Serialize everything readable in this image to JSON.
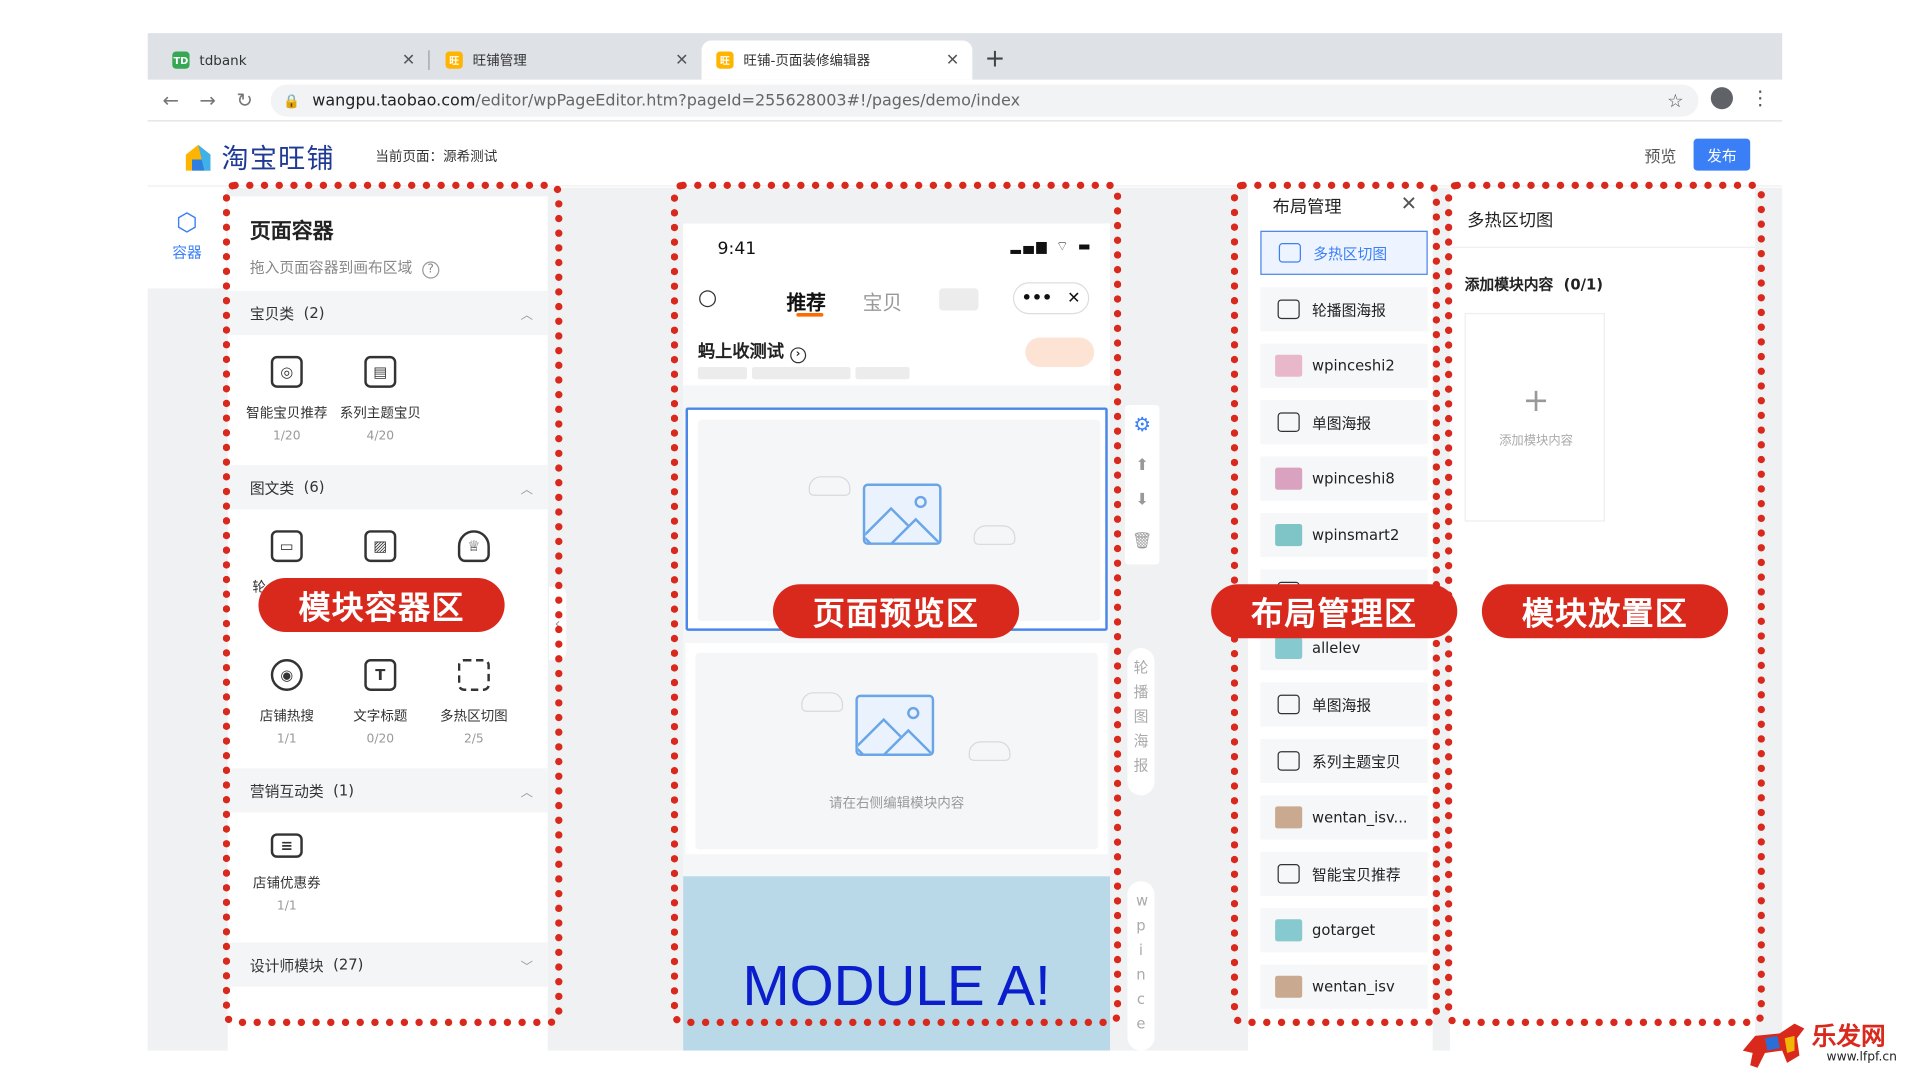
{
  "browser": {
    "tabs": [
      {
        "title": "tdbank",
        "favicon": "TD"
      },
      {
        "title": "旺铺管理"
      },
      {
        "title": "旺铺-页面装修编辑器"
      }
    ],
    "url_host": "wangpu.taobao.com",
    "url_path": "/editor/wpPageEditor.htm?pageId=255628003#!/pages/demo/index",
    "new_tab_icon": "+"
  },
  "app": {
    "logo_text": "淘宝旺铺",
    "current_page_label": "当前页面：",
    "current_page_value": "源希测试",
    "preview_button": "预览",
    "publish_button": "发布",
    "rail_label": "容器",
    "accent_color": "#3b7ff6"
  },
  "container_panel": {
    "title": "页面容器",
    "subtitle": "拖入页面容器到画布区域",
    "categories": [
      {
        "name": "宝贝类",
        "count": "(2)"
      },
      {
        "name": "图文类",
        "count": "(6)"
      },
      {
        "name": "营销互动类",
        "count": "(1)"
      },
      {
        "name": "设计师模块",
        "count": "(27)"
      }
    ],
    "modules": [
      {
        "name": "智能宝贝推荐",
        "count": "1/20"
      },
      {
        "name": "系列主题宝贝",
        "count": "4/20"
      },
      {
        "name": "店铺热搜",
        "count": "1/1"
      },
      {
        "name": "文字标题",
        "count": "0/20"
      },
      {
        "name": "多热区切图",
        "count": "2/5"
      },
      {
        "name": "店铺优惠券",
        "count": "1/1"
      }
    ],
    "partial_label": "轮"
  },
  "preview": {
    "time": "9:41",
    "tab_active": "推荐",
    "tab_other": "宝贝",
    "shop_name": "蚂上收测试",
    "placeholder_hint": "请在右侧编辑模块内容",
    "module_a_text": "MODULE A!",
    "side_label_1": "轮播图海报",
    "side_label_2": "wpince"
  },
  "layout_panel": {
    "title": "布局管理",
    "items": [
      {
        "name": "多热区切图",
        "kind": "icon",
        "selected": true
      },
      {
        "name": "轮播图海报",
        "kind": "icon"
      },
      {
        "name": "wpinceshi2",
        "kind": "thumb",
        "color": "#e8b7c9"
      },
      {
        "name": "单图海报",
        "kind": "icon"
      },
      {
        "name": "wpinceshi8",
        "kind": "thumb",
        "color": "#d9a3c0"
      },
      {
        "name": "wpinsmart2",
        "kind": "thumb",
        "color": "#7fc4c7"
      },
      {
        "name": "单图海报",
        "kind": "icon"
      },
      {
        "name": "allelev",
        "kind": "thumb",
        "color": "#86c9cf"
      },
      {
        "name": "单图海报",
        "kind": "icon"
      },
      {
        "name": "系列主题宝贝",
        "kind": "icon"
      },
      {
        "name": "wentan_isv...",
        "kind": "thumb",
        "color": "#c9a98f"
      },
      {
        "name": "智能宝贝推荐",
        "kind": "icon"
      },
      {
        "name": "gotarget",
        "kind": "thumb",
        "color": "#86c9cf"
      },
      {
        "name": "wentan_isv",
        "kind": "thumb",
        "color": "#c9a98f"
      }
    ]
  },
  "placement_panel": {
    "title": "多热区切图",
    "subtitle": "添加模块内容",
    "subtitle_count": "(0/1)",
    "add_label": "添加模块内容"
  },
  "callouts": [
    "模块容器区",
    "页面预览区",
    "布局管理区",
    "模块放置区"
  ],
  "annotation_color": "#d9281c",
  "watermark": {
    "text": "乐发网",
    "url": "www.lfpf.cn"
  }
}
